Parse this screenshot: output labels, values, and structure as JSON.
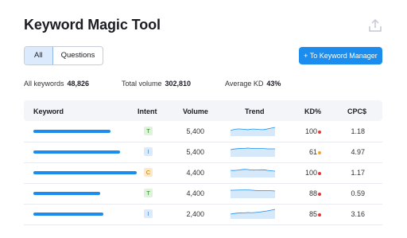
{
  "page": {
    "title": "Keyword Magic Tool"
  },
  "tabs": [
    {
      "label": "All",
      "active": true
    },
    {
      "label": "Questions",
      "active": false
    }
  ],
  "cta_label": "+ To Keyword Manager",
  "summary": {
    "all_keywords_label": "All keywords",
    "all_keywords_value": "48,826",
    "total_volume_label": "Total volume",
    "total_volume_value": "302,810",
    "average_kd_label": "Average KD",
    "average_kd_value": "43%"
  },
  "table": {
    "headers": {
      "keyword": "Keyword",
      "intent": "Intent",
      "volume": "Volume",
      "trend": "Trend",
      "kd": "KD%",
      "cpc": "CPC$"
    },
    "rows": [
      {
        "keyword_fill": 0.7,
        "intent": "T",
        "volume": "5,400",
        "kd": "100",
        "kd_color": "#e5383b",
        "cpc": "1.18"
      },
      {
        "keyword_fill": 0.79,
        "intent": "I",
        "volume": "5,400",
        "kd": "61",
        "kd_color": "#f5a623",
        "cpc": "4.97"
      },
      {
        "keyword_fill": 0.94,
        "intent": "C",
        "volume": "4,400",
        "kd": "100",
        "kd_color": "#e5383b",
        "cpc": "1.17"
      },
      {
        "keyword_fill": 0.61,
        "intent": "T",
        "volume": "4,400",
        "kd": "88",
        "kd_color": "#e5383b",
        "cpc": "0.59"
      },
      {
        "keyword_fill": 0.64,
        "intent": "I",
        "volume": "2,400",
        "kd": "85",
        "kd_color": "#e5383b",
        "cpc": "3.16"
      }
    ]
  },
  "intent_colors": {
    "T": {
      "bg": "#dff3da",
      "fg": "#2f8a2a"
    },
    "I": {
      "bg": "#dcebfb",
      "fg": "#3b7fd0"
    },
    "C": {
      "bg": "#fde9c6",
      "fg": "#c77b00"
    }
  },
  "colors": {
    "accent": "#1a8dee",
    "trend_fill": "#d6e9fb",
    "trend_line": "#1a8dee"
  },
  "icons": {
    "export": "export-icon"
  }
}
